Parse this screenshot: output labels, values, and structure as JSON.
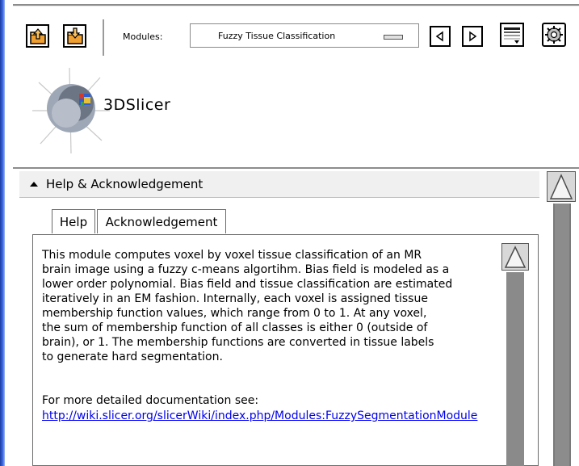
{
  "toolbar": {
    "modules_label": "Modules:",
    "module_selected": "Fuzzy Tissue Classification"
  },
  "logo": {
    "text": "3DSlicer"
  },
  "help_panel": {
    "title": "Help & Acknowledgement",
    "tabs": [
      "Help",
      "Acknowledgement"
    ],
    "body": "This module computes voxel by voxel tissue classification of an MR\nbrain image using a fuzzy c-means algortihm. Bias field is modeled as a\nlower order polynomial. Bias field and tissue classification are estimated\niteratively in an EM fashion. Internally, each voxel is assigned tissue\nmembership function values, which range from 0 to 1. At any voxel,\nthe sum of membership function of all classes is either 0 (outside of\nbrain), or 1. The membership functions are converted in tissue labels\nto generate hard segmentation.",
    "doc_label": "For more detailed documentation see:",
    "doc_link": "http://wiki.slicer.org/slicerWiki/index.php/Modules:FuzzySegmentationModule"
  },
  "colors": {
    "left_edge": "#3f6ee8",
    "icon_orange": "#f0a030",
    "link": "#0000ee"
  }
}
